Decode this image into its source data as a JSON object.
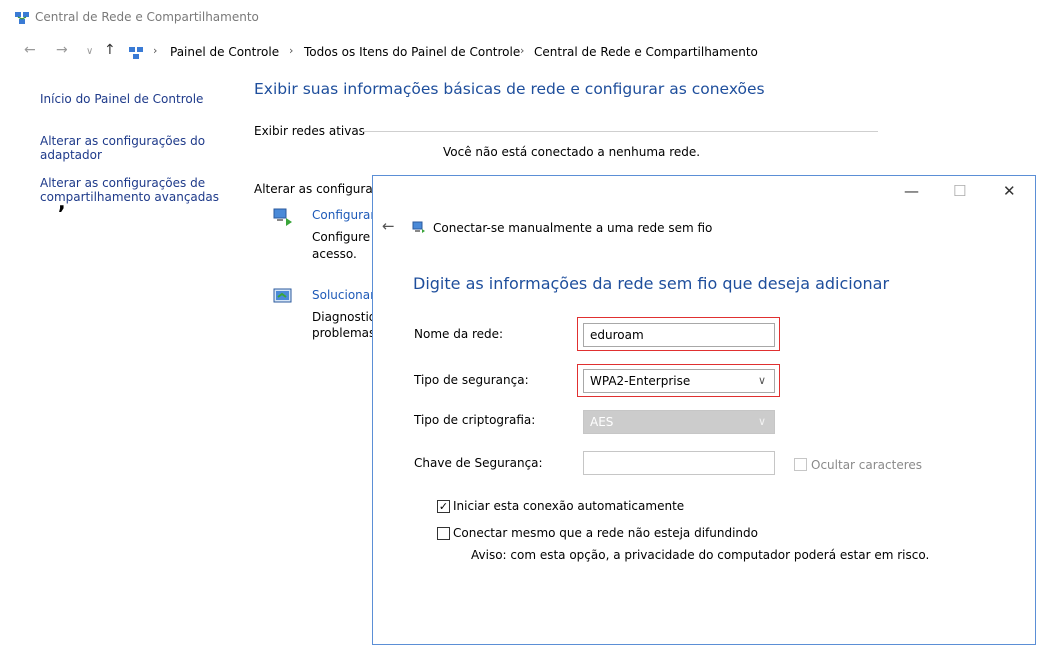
{
  "window": {
    "title": "Central de Rede e Compartilhamento",
    "icon": "network-icon"
  },
  "address_bar": {
    "breadcrumbs": [
      "Painel de Controle",
      "Todos os Itens do Painel de Controle",
      "Central de Rede e Compartilhamento"
    ]
  },
  "sidebar": {
    "items": [
      {
        "label": "Início do Painel de Controle"
      },
      {
        "label_line1": "Alterar as configurações do",
        "label_line2": "adaptador"
      },
      {
        "label_line1": "Alterar as configurações de",
        "label_line2": "compartilhamento avançadas"
      }
    ]
  },
  "main": {
    "title": "Exibir suas informações básicas de rede e configurar as conexões",
    "active_networks_label": "Exibir redes ativas",
    "not_connected_text": "Você não está conectado a nenhuma rede.",
    "change_settings_label": "Alterar as configuraç",
    "tasks": [
      {
        "title": "Configurar",
        "desc_line1": "Configure",
        "desc_line2": "acesso.",
        "icon": "network-setup-icon"
      },
      {
        "title": "Solucionar",
        "desc_line1": "Diagnostiq",
        "desc_line2": "problemas",
        "icon": "troubleshoot-icon"
      }
    ]
  },
  "dialog": {
    "title": "Conectar-se manualmente a uma rede sem fio",
    "heading": "Digite as informações da rede sem fio que deseja adicionar",
    "controls": {
      "minimize": "—",
      "maximize": "☐",
      "close": "✕"
    },
    "network_name": {
      "label": "Nome da rede:",
      "value": "eduroam"
    },
    "security_type": {
      "label": "Tipo de segurança:",
      "value": "WPA2-Enterprise"
    },
    "encryption_type": {
      "label": "Tipo de criptografia:",
      "value": "AES"
    },
    "security_key": {
      "label": "Chave de Segurança:",
      "value": "",
      "hide_chars_label": "Ocultar caracteres"
    },
    "auto_connect": {
      "label": "Iniciar esta conexão automaticamente",
      "checked": true
    },
    "connect_hidden": {
      "label": "Conectar mesmo que a rede não esteja difundindo",
      "checked": false
    },
    "warning": "Aviso: com esta opção, a privacidade do computador poderá estar em risco."
  },
  "colors": {
    "link": "#1e3a8a",
    "heading": "#1e4e9c",
    "highlight": "#e03030"
  }
}
